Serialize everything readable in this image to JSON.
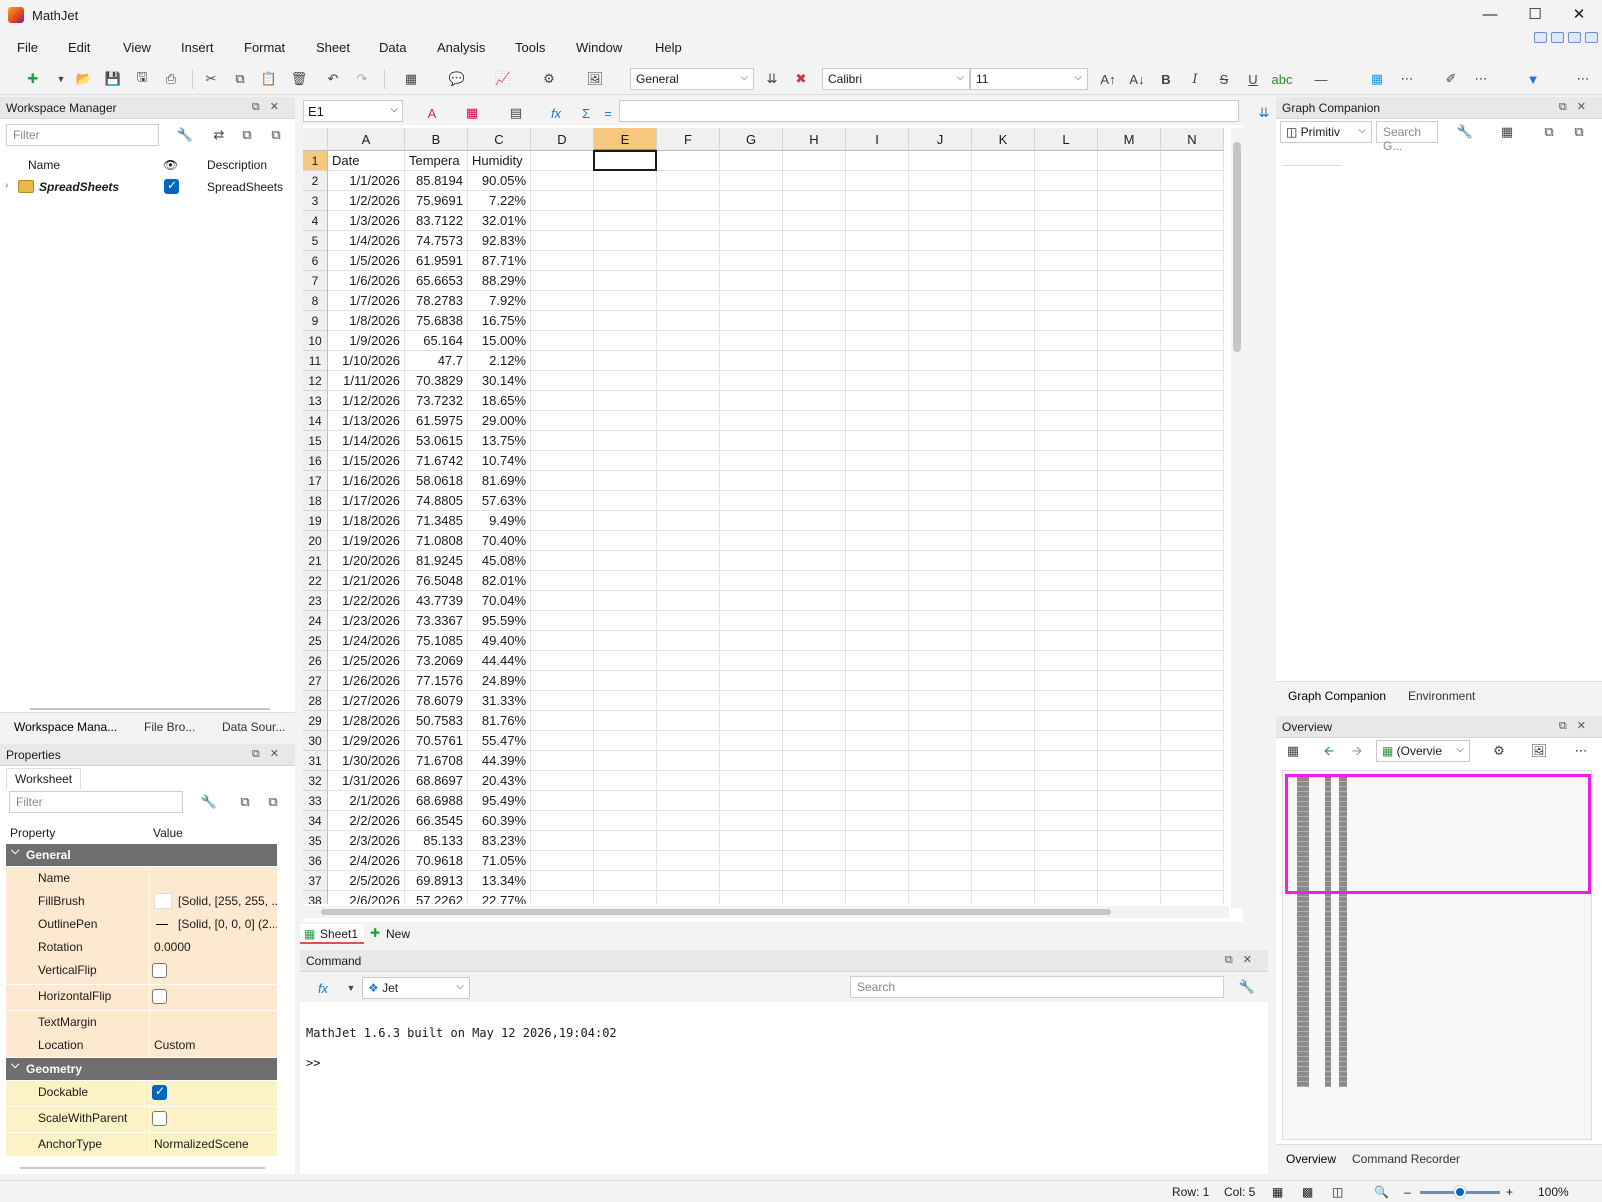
{
  "app": {
    "title": "MathJet"
  },
  "menu": [
    "File",
    "Edit",
    "View",
    "Insert",
    "Format",
    "Sheet",
    "Data",
    "Analysis",
    "Tools",
    "Window",
    "Help"
  ],
  "toolbar": {
    "number_format": "General",
    "font_family": "Calibri",
    "font_size": "11"
  },
  "workspace": {
    "title": "Workspace Manager",
    "filter_placeholder": "Filter",
    "col_name": "Name",
    "col_desc": "Description",
    "row": {
      "name": "SpreadSheets",
      "description": "SpreadSheets",
      "visible": true
    },
    "tabs": [
      "Workspace Mana...",
      "File Bro...",
      "Data Sour..."
    ]
  },
  "properties": {
    "title": "Properties",
    "tab": "Worksheet",
    "filter_placeholder": "Filter",
    "col_property": "Property",
    "col_value": "Value",
    "group_general": "General",
    "group_geometry": "Geometry",
    "rows": {
      "name": {
        "label": "Name",
        "value": ""
      },
      "fillbrush": {
        "label": "FillBrush",
        "value": "[Solid, [255, 255, ..."
      },
      "outlinepen": {
        "label": "OutlinePen",
        "value": "[Solid, [0, 0, 0] (2..."
      },
      "rotation": {
        "label": "Rotation",
        "value": "0.0000"
      },
      "verticalflip": {
        "label": "VerticalFlip"
      },
      "horizontalflip": {
        "label": "HorizontalFlip"
      },
      "textmargin": {
        "label": "TextMargin",
        "value": ""
      },
      "location": {
        "label": "Location",
        "value": "Custom"
      },
      "dockable": {
        "label": "Dockable"
      },
      "scalewithparent": {
        "label": "ScaleWithParent"
      },
      "anchortype": {
        "label": "AnchorType",
        "value": "NormalizedScene"
      }
    }
  },
  "sheet": {
    "name_box": "E1",
    "columns": [
      "A",
      "B",
      "C",
      "D",
      "E",
      "F",
      "G",
      "H",
      "I",
      "J",
      "K",
      "L",
      "M",
      "N"
    ],
    "selected_col": "E",
    "selected_row": 1,
    "header_row": [
      "Date",
      "Tempera",
      "Humidity"
    ],
    "rows": [
      [
        "1/1/2026",
        "85.8194",
        "90.05%"
      ],
      [
        "1/2/2026",
        "75.9691",
        "7.22%"
      ],
      [
        "1/3/2026",
        "83.7122",
        "32.01%"
      ],
      [
        "1/4/2026",
        "74.7573",
        "92.83%"
      ],
      [
        "1/5/2026",
        "61.9591",
        "87.71%"
      ],
      [
        "1/6/2026",
        "65.6653",
        "88.29%"
      ],
      [
        "1/7/2026",
        "78.2783",
        "7.92%"
      ],
      [
        "1/8/2026",
        "75.6838",
        "16.75%"
      ],
      [
        "1/9/2026",
        "65.164",
        "15.00%"
      ],
      [
        "1/10/2026",
        "47.7",
        "2.12%"
      ],
      [
        "1/11/2026",
        "70.3829",
        "30.14%"
      ],
      [
        "1/12/2026",
        "73.7232",
        "18.65%"
      ],
      [
        "1/13/2026",
        "61.5975",
        "29.00%"
      ],
      [
        "1/14/2026",
        "53.0615",
        "13.75%"
      ],
      [
        "1/15/2026",
        "71.6742",
        "10.74%"
      ],
      [
        "1/16/2026",
        "58.0618",
        "81.69%"
      ],
      [
        "1/17/2026",
        "74.8805",
        "57.63%"
      ],
      [
        "1/18/2026",
        "71.3485",
        "9.49%"
      ],
      [
        "1/19/2026",
        "71.0808",
        "70.40%"
      ],
      [
        "1/20/2026",
        "81.9245",
        "45.08%"
      ],
      [
        "1/21/2026",
        "76.5048",
        "82.01%"
      ],
      [
        "1/22/2026",
        "43.7739",
        "70.04%"
      ],
      [
        "1/23/2026",
        "73.3367",
        "95.59%"
      ],
      [
        "1/24/2026",
        "75.1085",
        "49.40%"
      ],
      [
        "1/25/2026",
        "73.2069",
        "44.44%"
      ],
      [
        "1/26/2026",
        "77.1576",
        "24.89%"
      ],
      [
        "1/27/2026",
        "78.6079",
        "31.33%"
      ],
      [
        "1/28/2026",
        "50.7583",
        "81.76%"
      ],
      [
        "1/29/2026",
        "70.5761",
        "55.47%"
      ],
      [
        "1/30/2026",
        "71.6708",
        "44.39%"
      ],
      [
        "1/31/2026",
        "68.8697",
        "20.43%"
      ],
      [
        "2/1/2026",
        "68.6988",
        "95.49%"
      ],
      [
        "2/2/2026",
        "66.3545",
        "60.39%"
      ],
      [
        "2/3/2026",
        "85.133",
        "83.23%"
      ],
      [
        "2/4/2026",
        "70.9618",
        "71.05%"
      ],
      [
        "2/5/2026",
        "69.8913",
        "13.34%"
      ],
      [
        "2/6/2026",
        "57.2262",
        "22.77%"
      ]
    ],
    "tabs": {
      "sheet1": "Sheet1",
      "new": "New"
    }
  },
  "command": {
    "title": "Command",
    "lang": "Jet",
    "search_placeholder": "Search",
    "line1": "MathJet 1.6.3 built on May 12 2026,19:04:02",
    "prompt": ">>"
  },
  "graph_companion": {
    "title": "Graph Companion",
    "primitive": "Primitiv",
    "search_placeholder": "Search G...",
    "tabs": [
      "Graph Companion",
      "Environment"
    ]
  },
  "overview": {
    "title": "Overview",
    "combo": "(Overvie",
    "tabs": [
      "Overview",
      "Command Recorder"
    ]
  },
  "status": {
    "row": "Row: 1",
    "col": "Col: 5",
    "zoom": "100%"
  }
}
